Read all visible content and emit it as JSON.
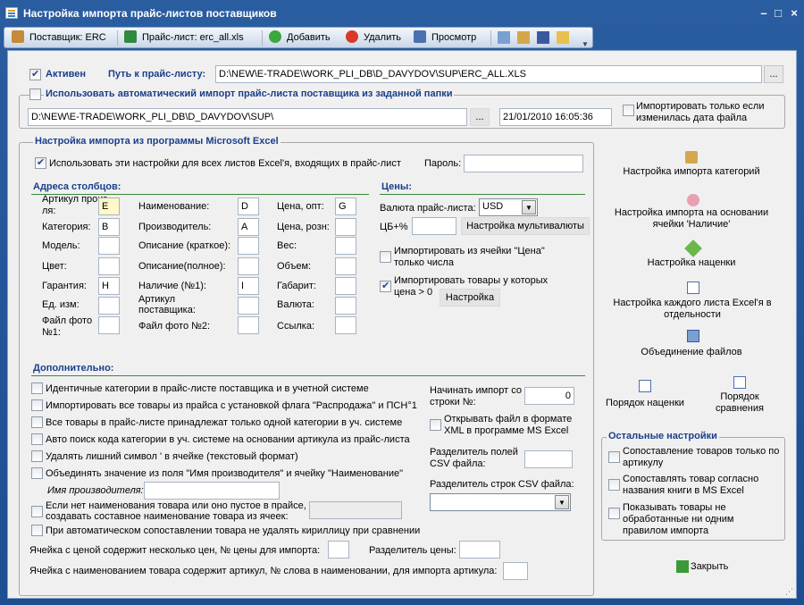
{
  "window": {
    "title": "Настройка импорта прайс-листов поставщиков"
  },
  "toolbar": {
    "supplier": "Поставщик: ERC",
    "pricelist": "Прайс-лист: erc_all.xls",
    "add": "Добавить",
    "delete": "Удалить",
    "view": "Просмотр"
  },
  "top": {
    "active": "Активен",
    "path_label": "Путь к прайс-листу:",
    "path_value": "D:\\NEW\\E-TRADE\\WORK_PLI_DB\\D_DAVYDOV\\SUP\\ERC_ALL.XLS",
    "browse": "...",
    "auto_label": "Использовать автоматический импорт прайс-листа поставщика из заданной папки",
    "folder_value": "D:\\NEW\\E-TRADE\\WORK_PLI_DB\\D_DAVYDOV\\SUP\\",
    "date_value": "21/01/2010 16:05:36",
    "only_changed": "Импортировать только если изменилась дата файла"
  },
  "excel": {
    "title": "Настройка импорта из программы Microsoft Excel",
    "use_all_sheets": "Использовать эти настройки для всех листов Excel'я, входящих в прайс-лист",
    "password_label": "Пароль:",
    "columns_title": "Адреса столбцов:",
    "col1": [
      {
        "label": "Артикул произ-ля:",
        "value": "E"
      },
      {
        "label": "Категория:",
        "value": "B"
      },
      {
        "label": "Модель:",
        "value": ""
      },
      {
        "label": "Цвет:",
        "value": ""
      },
      {
        "label": "Гарантия:",
        "value": "H"
      },
      {
        "label": "Ед. изм:",
        "value": ""
      },
      {
        "label": "Файл фото №1:",
        "value": ""
      }
    ],
    "col2": [
      {
        "label": "Наименование:",
        "value": "D"
      },
      {
        "label": "Производитель:",
        "value": "A"
      },
      {
        "label": "Описание (краткое):",
        "value": ""
      },
      {
        "label": "Описание(полное):",
        "value": ""
      },
      {
        "label": "Наличие (№1):",
        "value": "I"
      },
      {
        "label": "Артикул поставщика:",
        "value": ""
      },
      {
        "label": "Файл фото №2:",
        "value": ""
      }
    ],
    "col3": [
      {
        "label": "Цена, опт:",
        "value": "G"
      },
      {
        "label": "Цена, розн:",
        "value": ""
      },
      {
        "label": "Вес:",
        "value": ""
      },
      {
        "label": "Объем:",
        "value": ""
      },
      {
        "label": "Габарит:",
        "value": ""
      },
      {
        "label": "Валюта:",
        "value": ""
      },
      {
        "label": "Ссылка:",
        "value": ""
      }
    ],
    "prices_title": "Цены:",
    "currency_label": "Валюта прайс-листа:",
    "currency_value": "USD",
    "cb_label": "ЦБ+%",
    "multiplier_btn": "Настройка мультивалюты",
    "import_price_cell": "Импортировать из ячейки \"Цена\" только числа",
    "import_price_gt0": "Импортировать товары у которых цена > 0",
    "setup_btn": "Настройка"
  },
  "extra": {
    "title": "Дополнительно:",
    "options": [
      {
        "label": "Идентичные категории в прайс-листе поставщика и в учетной системе",
        "checked": false
      },
      {
        "label": "Импортировать все товары из прайса с установкой флага \"Распродажа\" и ПСН°1",
        "checked": false
      },
      {
        "label": "Все товары в прайс-листе принадлежат только одной категории в уч. системе",
        "checked": false
      },
      {
        "label": "Авто поиск кода категории в уч. системе на основании артикула из прайс-листа",
        "checked": false
      },
      {
        "label": "Удалять лишний символ ' в ячейке (текстовый формат)",
        "checked": false
      },
      {
        "label": "Объединять значение из поля \"Имя производителя\" и ячейку \"Наименование\"",
        "checked": false
      }
    ],
    "manufacturer_label": "Имя производителя:",
    "no_name_label": "Если нет наименования товара или оно пустое в прайсе, создавать составное наименование товара из ячеек:",
    "cyrillic_label": "При автоматическом сопоставлении товара не удалять кириллицу при сравнении",
    "multi_price_label": "Ячейка с ценой содержит несколько цен, № цены для импорта:",
    "price_sep_label": "Разделитель цены:",
    "article_word_label": "Ячейка с наименованием товара содержит артикул, № слова в наименовании, для импорта артикула:",
    "start_row_label": "Начинать импорт со строки №:",
    "start_row_value": "0",
    "open_xml_label": "Открывать файл в формате XML в программе MS Excel",
    "csv_field_label": "Разделитель полей CSV файла:",
    "csv_row_label": "Разделитель строк CSV файла:"
  },
  "side": {
    "category_setup": "Настройка импорта категорий",
    "stock_setup": "Настройка импорта на основании ячейки 'Наличие'",
    "markup_setup": "Настройка наценки",
    "each_sheet": "Настройка каждого листа Excel'я в отдельности",
    "merge_files": "Объединение файлов",
    "markup_order": "Порядок наценки",
    "compare_order": "Порядок сравнения",
    "other_title": "Остальные настройки",
    "other": [
      {
        "label": "Сопоставление товаров только по артикулу",
        "checked": false
      },
      {
        "label": "Сопоставлять товар согласно названия книги в MS Excel",
        "checked": false
      },
      {
        "label": "Показывать товары не обработанные ни одним правилом импорта",
        "checked": false
      }
    ],
    "close": "Закрыть"
  }
}
